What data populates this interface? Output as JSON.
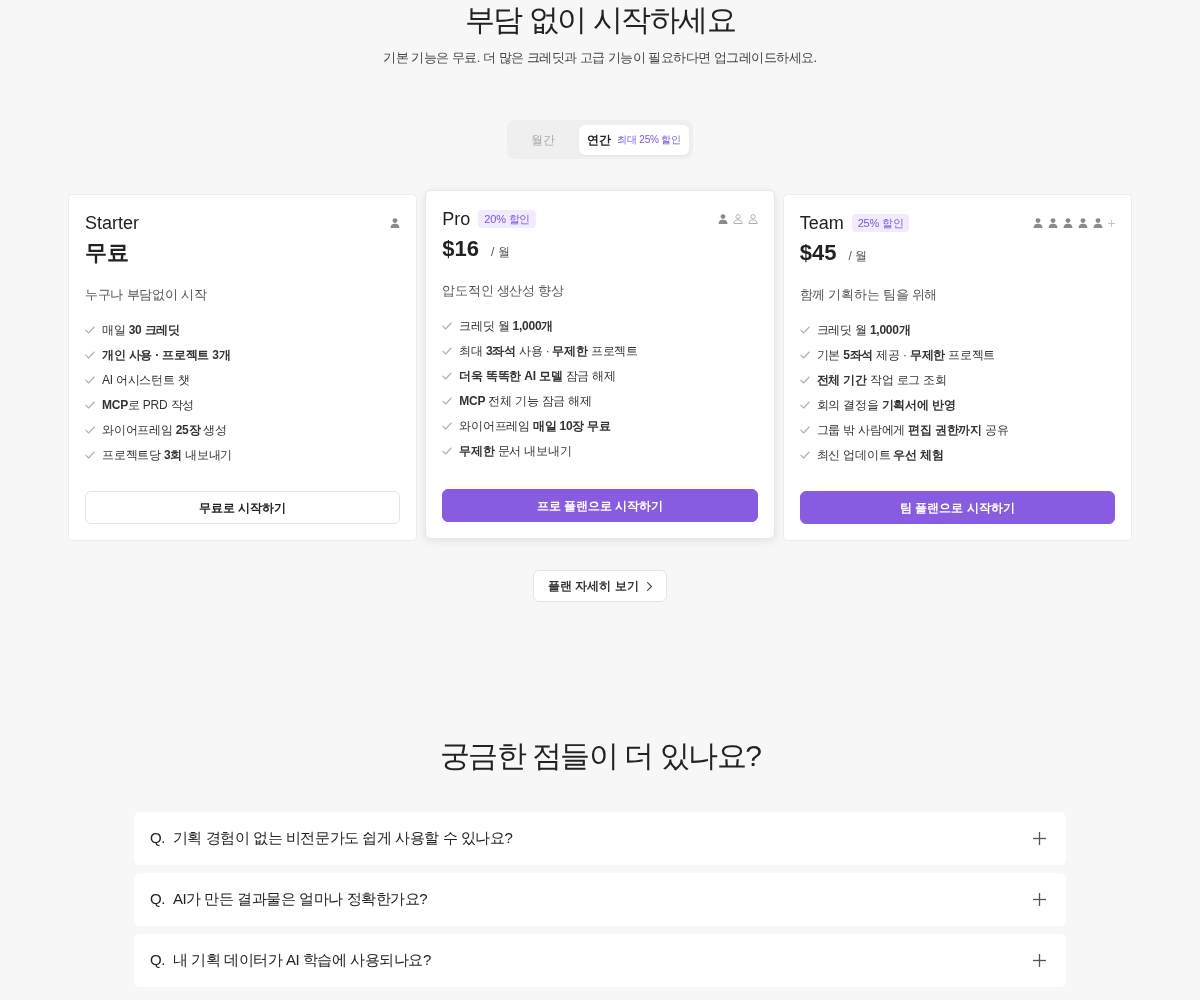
{
  "header": {
    "title": "부담 없이 시작하세요",
    "subtitle": "기본 기능은 무료. 더 많은 크레딧과 고급 기능이 필요하다면 업그레이드하세요."
  },
  "billing_toggle": [
    {
      "label": "월간",
      "selected": false
    },
    {
      "label": "연간",
      "selected": true,
      "badge": "최대 25% 할인"
    }
  ],
  "plans": [
    {
      "name": "Starter",
      "featured": false,
      "seats": [
        {
          "filled": true
        }
      ],
      "more_seats": false,
      "price": "무료",
      "description": "누구나 부담없이 시작",
      "features": [
        "매일 **30 크레딧**",
        "**개인 사용 · 프로젝트 3개**",
        "AI 어시스턴트 챗",
        "**MCP**로 PRD 작성",
        "와이어프레임 **25장** 생성",
        "프로젝트당 **3회** 내보내기"
      ],
      "button": {
        "label": "무료로 시작하기",
        "kind": "outline"
      }
    },
    {
      "name": "Pro",
      "discount": "20% 할인",
      "featured": true,
      "seats": [
        {
          "filled": true
        },
        {
          "filled": false
        },
        {
          "filled": false
        }
      ],
      "more_seats": false,
      "price": "$16",
      "period": "/ 월",
      "description": "압도적인 생산성 향상",
      "features": [
        "크레딧 월 **1,000개**",
        "최대 **3좌석** 사용 · **무제한** 프로젝트",
        "**더욱 똑똑한 AI 모델** 잠금 해제",
        "**MCP** 전체 기능 잠금 해제",
        "와이어프레임 **매일 10장 무료**",
        "**무제한** 문서 내보내기"
      ],
      "button": {
        "label": "프로 플랜으로 시작하기",
        "kind": "primary"
      }
    },
    {
      "name": "Team",
      "discount": "25% 할인",
      "featured": false,
      "seats": [
        {
          "filled": true
        },
        {
          "filled": true
        },
        {
          "filled": true
        },
        {
          "filled": true
        },
        {
          "filled": true
        }
      ],
      "more_seats": true,
      "price": "$45",
      "period": "/ 월",
      "description": "함께 기획하는 팀을 위해",
      "features": [
        "크레딧 월 **1,000개**",
        "기본 **5좌석** 제공 · **무제한** 프로젝트",
        "**전체 기간** 작업 로그 조회",
        "회의 결정을 **기획서에 반영**",
        "그룹 밖 사람에게 **편집 권한까지** 공유",
        "최신 업데이트 **우선 체험**"
      ],
      "button": {
        "label": "팀 플랜으로 시작하기",
        "kind": "primary"
      }
    }
  ],
  "details_button": {
    "label": "플랜 자세히 보기"
  },
  "faq": {
    "title": "궁금한 점들이 더 있나요?",
    "items": [
      {
        "prefix": "Q.",
        "question": "기획 경험이 없는 비전문가도 쉽게 사용할 수 있나요?",
        "expanded": false
      },
      {
        "prefix": "Q.",
        "question": "AI가 만든 결과물은 얼마나 정확한가요?",
        "expanded": false
      },
      {
        "prefix": "Q.",
        "question": "내 기획 데이터가 AI 학습에 사용되나요?",
        "expanded": false
      }
    ]
  }
}
